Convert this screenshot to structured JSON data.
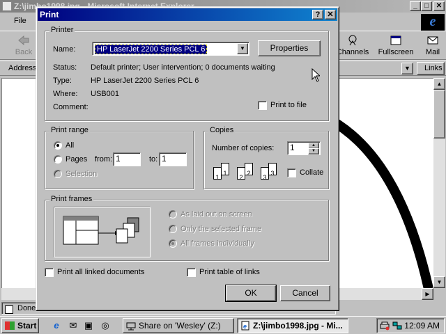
{
  "ie": {
    "title": "Z:\\jimbo1998.jpg - Microsoft Internet Explorer",
    "menu_file": "File",
    "toolbar": {
      "back": "Back",
      "channels": "Channels",
      "fullscreen": "Fullscreen",
      "mail": "Mail"
    },
    "address_label": "Address",
    "links_label": "Links",
    "status_text": "Done"
  },
  "dialog": {
    "title": "Print",
    "printer": {
      "group_label": "Printer",
      "name_label": "Name:",
      "name_value": "HP LaserJet 2200 Series PCL 6",
      "properties_button": "Properties",
      "status_label": "Status:",
      "status_value": "Default printer; User intervention; 0 documents waiting",
      "type_label": "Type:",
      "type_value": "HP LaserJet 2200 Series PCL 6",
      "where_label": "Where:",
      "where_value": "USB001",
      "comment_label": "Comment:",
      "print_to_file": "Print to file"
    },
    "range": {
      "group_label": "Print range",
      "all": "All",
      "pages": "Pages",
      "from_label": "from:",
      "from_value": "1",
      "to_label": "to:",
      "to_value": "1",
      "selection": "Selection"
    },
    "copies": {
      "group_label": "Copies",
      "number_label": "Number of copies:",
      "number_value": "1",
      "collate": "Collate",
      "stack_labels": [
        "1",
        "1",
        "2",
        "2",
        "3",
        "3"
      ]
    },
    "frames": {
      "group_label": "Print frames",
      "as_laid_out": "As laid out on screen",
      "only_selected": "Only the selected frame",
      "all_individually": "All frames individually"
    },
    "print_linked": "Print all linked documents",
    "print_table_links": "Print table of links",
    "ok_button": "OK",
    "cancel_button": "Cancel"
  },
  "taskbar": {
    "start": "Start",
    "task_share": "Share on 'Wesley' (Z:)",
    "task_ie": "Z:\\jimbo1998.jpg - Mi...",
    "clock": "12:09 AM"
  },
  "colors": {
    "dialog_title": "#000080",
    "selection": "#000080",
    "face": "#c0c0c0"
  }
}
